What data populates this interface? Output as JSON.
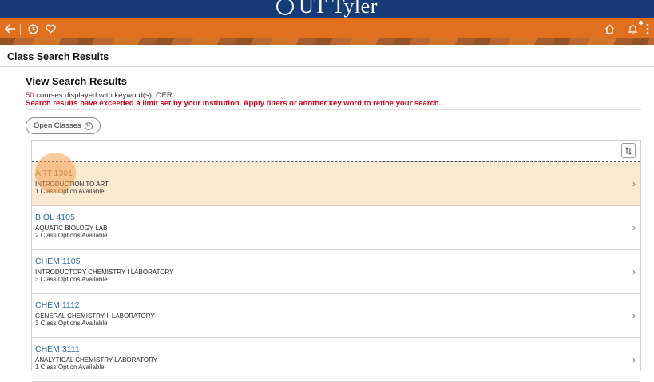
{
  "brand": {
    "name": "UT Tyler"
  },
  "nav": {
    "back_icon": "back-arrow-icon",
    "history_icon": "clock-icon",
    "favorites_icon": "heart-icon",
    "home_icon": "home-icon",
    "notifications_icon": "bell-icon"
  },
  "page": {
    "title": "Class Search Results"
  },
  "results": {
    "heading": "View Search Results",
    "count": "50",
    "count_text": " courses displayed with keyword(s): OER",
    "warning": "Search results have exceeded a limit set by your institution. Apply filters or another key word to refine your search.",
    "filter_chip": "Open Classes",
    "sort_icon": "sort-arrows-icon",
    "courses": [
      {
        "code": "ART  1301",
        "name": "INTRODUCTION TO ART",
        "options": "1 Class Option Available"
      },
      {
        "code": "BIOL  4105",
        "name": "AQUATIC BIOLOGY LAB",
        "options": "2 Class Options Available"
      },
      {
        "code": "CHEM  1105",
        "name": "INTRODUCTORY CHEMISTRY I LABORATORY",
        "options": "3 Class Options Available"
      },
      {
        "code": "CHEM  1112",
        "name": "GENERAL CHEMISTRY II LABORATORY",
        "options": "3 Class Options Available"
      },
      {
        "code": "CHEM  3111",
        "name": "ANALYTICAL CHEMISTRY LABORATORY",
        "options": "1 Class Option Available"
      }
    ]
  },
  "colors": {
    "top_band": "#173b79",
    "nav_bar": "#e0701e",
    "link": "#2a6ca8",
    "warning": "#d0021b",
    "highlight_row": "#fbe9d2"
  }
}
